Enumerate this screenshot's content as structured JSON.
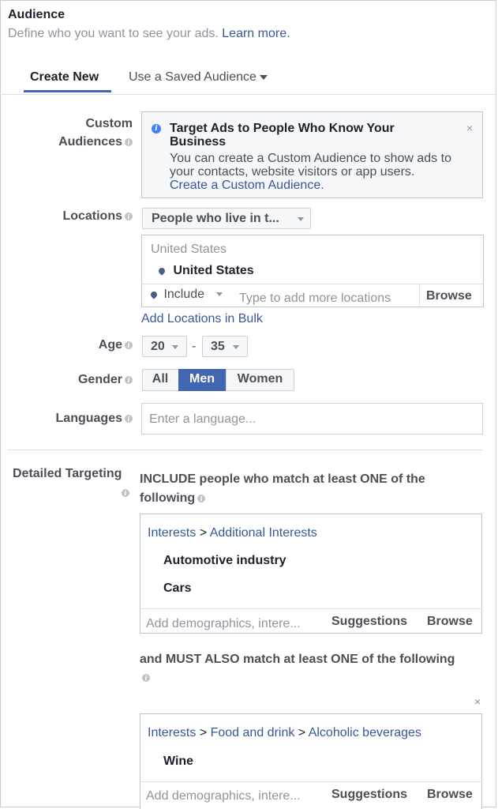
{
  "header": {
    "title": "Audience",
    "subtitle": "Define who you want to see your ads.",
    "learn_more": "Learn more."
  },
  "tabs": [
    {
      "label": "Create New",
      "active": true
    },
    {
      "label": "Use a Saved Audience",
      "active": false
    }
  ],
  "custom_audiences": {
    "label_line1": "Custom",
    "label_line2": "Audiences",
    "notice_title": "Target Ads to People Who Know Your Business",
    "notice_body": "You can create a Custom Audience to show ads to your contacts, website visitors or app users.",
    "notice_link": "Create a Custom Audience",
    "notice_end": ".",
    "close": "×"
  },
  "locations": {
    "label": "Locations",
    "dropdown_value": "People who live in t...",
    "group_header": "United States",
    "selected": "United States",
    "include_label": "Include",
    "input_placeholder": "Type to add more locations",
    "browse": "Browse",
    "bulk_link": "Add Locations in Bulk"
  },
  "age": {
    "label": "Age",
    "min": "20",
    "separator": "-",
    "max": "35"
  },
  "gender": {
    "label": "Gender",
    "options": [
      "All",
      "Men",
      "Women"
    ],
    "selected": "Men"
  },
  "languages": {
    "label": "Languages",
    "placeholder": "Enter a language..."
  },
  "detailed_targeting": {
    "label": "Detailed Targeting",
    "include_text_line1": "INCLUDE people who match at least ONE of the",
    "include_text_line2": "following",
    "group1": {
      "path": [
        "Interests",
        "Additional Interests"
      ],
      "separator": ">",
      "items": [
        "Automotive industry",
        "Cars"
      ],
      "input_placeholder": "Add demographics, intere...",
      "suggestions": "Suggestions",
      "browse": "Browse"
    },
    "must_also_text": "and MUST ALSO match at least ONE of the following",
    "close": "×",
    "group2": {
      "path": [
        "Interests",
        "Food and drink",
        "Alcoholic beverages"
      ],
      "separator": ">",
      "items": [
        "Wine"
      ],
      "input_placeholder": "Add demographics, intere...",
      "suggestions": "Suggestions",
      "browse": "Browse"
    }
  }
}
